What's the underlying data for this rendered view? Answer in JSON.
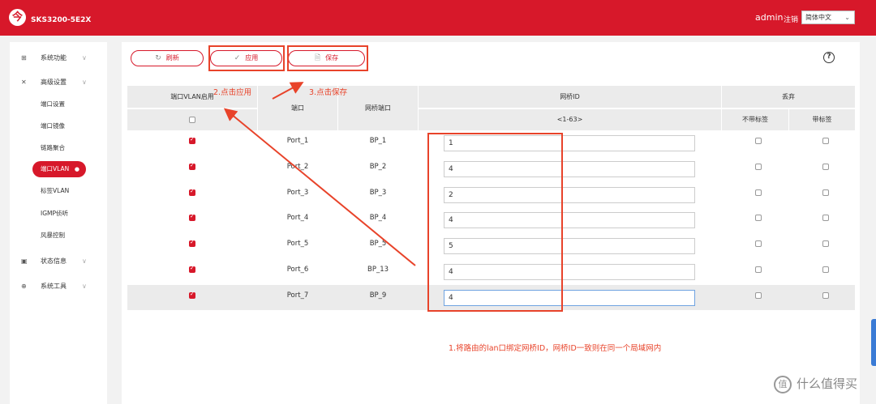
{
  "header": {
    "logo_glyph": "今",
    "model": "SKS3200-5E2X",
    "user": "admin",
    "logout": "注销",
    "language": "简体中文"
  },
  "sidebar": {
    "groups": [
      {
        "label": "系统功能",
        "icon": "grid-icon"
      },
      {
        "label": "高级设置",
        "icon": "tools-icon"
      },
      {
        "label": "状态信息",
        "icon": "monitor-icon"
      },
      {
        "label": "系统工具",
        "icon": "globe-icon"
      }
    ],
    "subitems": [
      "端口设置",
      "端口镜像",
      "链路聚合",
      "端口VLAN",
      "标签VLAN",
      "IGMP侦听",
      "风暴控制"
    ],
    "active": "端口VLAN"
  },
  "toolbar": {
    "refresh": "刷新",
    "apply": "应用",
    "save": "保存"
  },
  "table": {
    "headers": {
      "vlan_enable": "端口VLAN启用",
      "port": "端口",
      "bridge_port": "网桥端口",
      "bridge_id": "网桥ID",
      "bridge_range": "<1-63>",
      "discard": "丢弃",
      "untagged": "不带标签",
      "tagged": "带标签"
    },
    "rows": [
      {
        "port": "Port_1",
        "bridge_port": "BP_1",
        "bridge_id": "1",
        "enabled": true
      },
      {
        "port": "Port_2",
        "bridge_port": "BP_2",
        "bridge_id": "4",
        "enabled": true
      },
      {
        "port": "Port_3",
        "bridge_port": "BP_3",
        "bridge_id": "2",
        "enabled": true
      },
      {
        "port": "Port_4",
        "bridge_port": "BP_4",
        "bridge_id": "4",
        "enabled": true
      },
      {
        "port": "Port_5",
        "bridge_port": "BP_5",
        "bridge_id": "5",
        "enabled": true
      },
      {
        "port": "Port_6",
        "bridge_port": "BP_13",
        "bridge_id": "4",
        "enabled": true
      },
      {
        "port": "Port_7",
        "bridge_port": "BP_9",
        "bridge_id": "4",
        "enabled": true
      }
    ]
  },
  "annotations": {
    "step1": "1.将路由的lan口绑定网桥ID，网桥ID一致则在同一个局域网内",
    "step2": "2.点击应用",
    "step3": "3.点击保存"
  },
  "watermark": {
    "glyph": "值",
    "text": "什么值得买"
  },
  "colors": {
    "brand": "#d7182a",
    "annotation": "#e8432a"
  }
}
